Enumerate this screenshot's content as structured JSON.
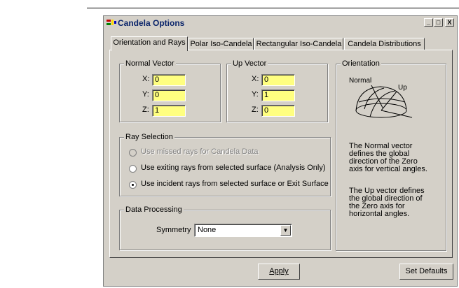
{
  "window": {
    "title": "Candela Options",
    "minimize_label": "_",
    "maximize_label": "□",
    "close_label": "X"
  },
  "tabs": [
    {
      "label": "Orientation and Rays",
      "active": true
    },
    {
      "label": "Polar Iso-Candela",
      "active": false
    },
    {
      "label": "Rectangular Iso-Candela",
      "active": false
    },
    {
      "label": "Candela Distributions",
      "active": false
    }
  ],
  "normal_vector": {
    "title": "Normal Vector",
    "x_label": "X:",
    "x_value": "0",
    "y_label": "Y:",
    "y_value": "0",
    "z_label": "Z:",
    "z_value": "1"
  },
  "up_vector": {
    "title": "Up Vector",
    "x_label": "X:",
    "x_value": "0",
    "y_label": "Y:",
    "y_value": "1",
    "z_label": "Z:",
    "z_value": "0"
  },
  "orientation": {
    "title": "Orientation",
    "diagram_normal_label": "Normal",
    "diagram_up_label": "Up",
    "desc1": [
      "The Normal vector",
      "defines the global",
      "direction of the Zero",
      "axis for vertical angles."
    ],
    "desc2": [
      "The Up vector defines",
      "the global direction of",
      "the Zero axis for",
      "horizontal angles."
    ]
  },
  "ray_selection": {
    "title": "Ray Selection",
    "options": [
      {
        "label": "Use missed rays for Candela Data",
        "checked": false,
        "disabled": true
      },
      {
        "label": "Use exiting rays from selected surface (Analysis Only)",
        "checked": false,
        "disabled": false
      },
      {
        "label": "Use incident rays from selected surface or Exit Surface",
        "checked": true,
        "disabled": false
      }
    ]
  },
  "data_processing": {
    "title": "Data Processing",
    "symmetry_label": "Symmetry",
    "symmetry_value": "None"
  },
  "buttons": {
    "apply": "Apply",
    "set_defaults": "Set Defaults"
  }
}
